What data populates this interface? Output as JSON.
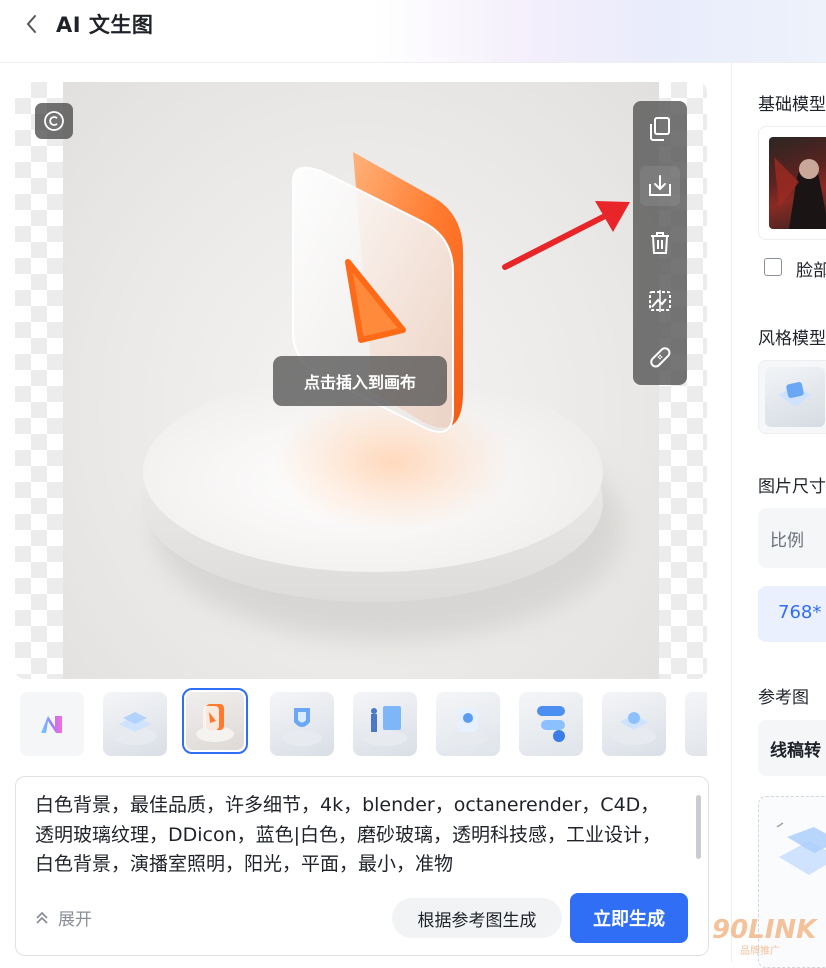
{
  "header": {
    "title": "AI 文生图"
  },
  "preview": {
    "insert_tip": "点击插入到画布",
    "toolbar": [
      "copy-icon",
      "download-icon",
      "delete-icon",
      "remove-background-icon",
      "repair-icon"
    ]
  },
  "thumbnails": {
    "count": 9,
    "selected_index": 2
  },
  "prompt": {
    "text": "白色背景，最佳品质，许多细节，4k，blender，octanerender，C4D，透明玻璃纹理，DDicon，蓝色|白色，磨砂玻璃，透明科技感，工业设计，白色背景，演播室照明，阳光，平面，最小，准物",
    "expand_label": "展开",
    "ref_generate_label": "根据参考图生成",
    "generate_label": "立即生成"
  },
  "right_panel": {
    "base_model_label": "基础模型",
    "face_label": "脸部",
    "style_model_label": "风格模型",
    "image_size_label": "图片尺寸",
    "ratio_label": "比例",
    "size_value": "768*",
    "reference_label": "参考图",
    "line_art_label": "线稿转"
  },
  "watermark": {
    "brand": "90LINK",
    "tagline": "品牌推广"
  },
  "colors": {
    "accent": "#2f6ef5",
    "orange": "#ff7a2e",
    "arrow_red": "#e8262a"
  }
}
